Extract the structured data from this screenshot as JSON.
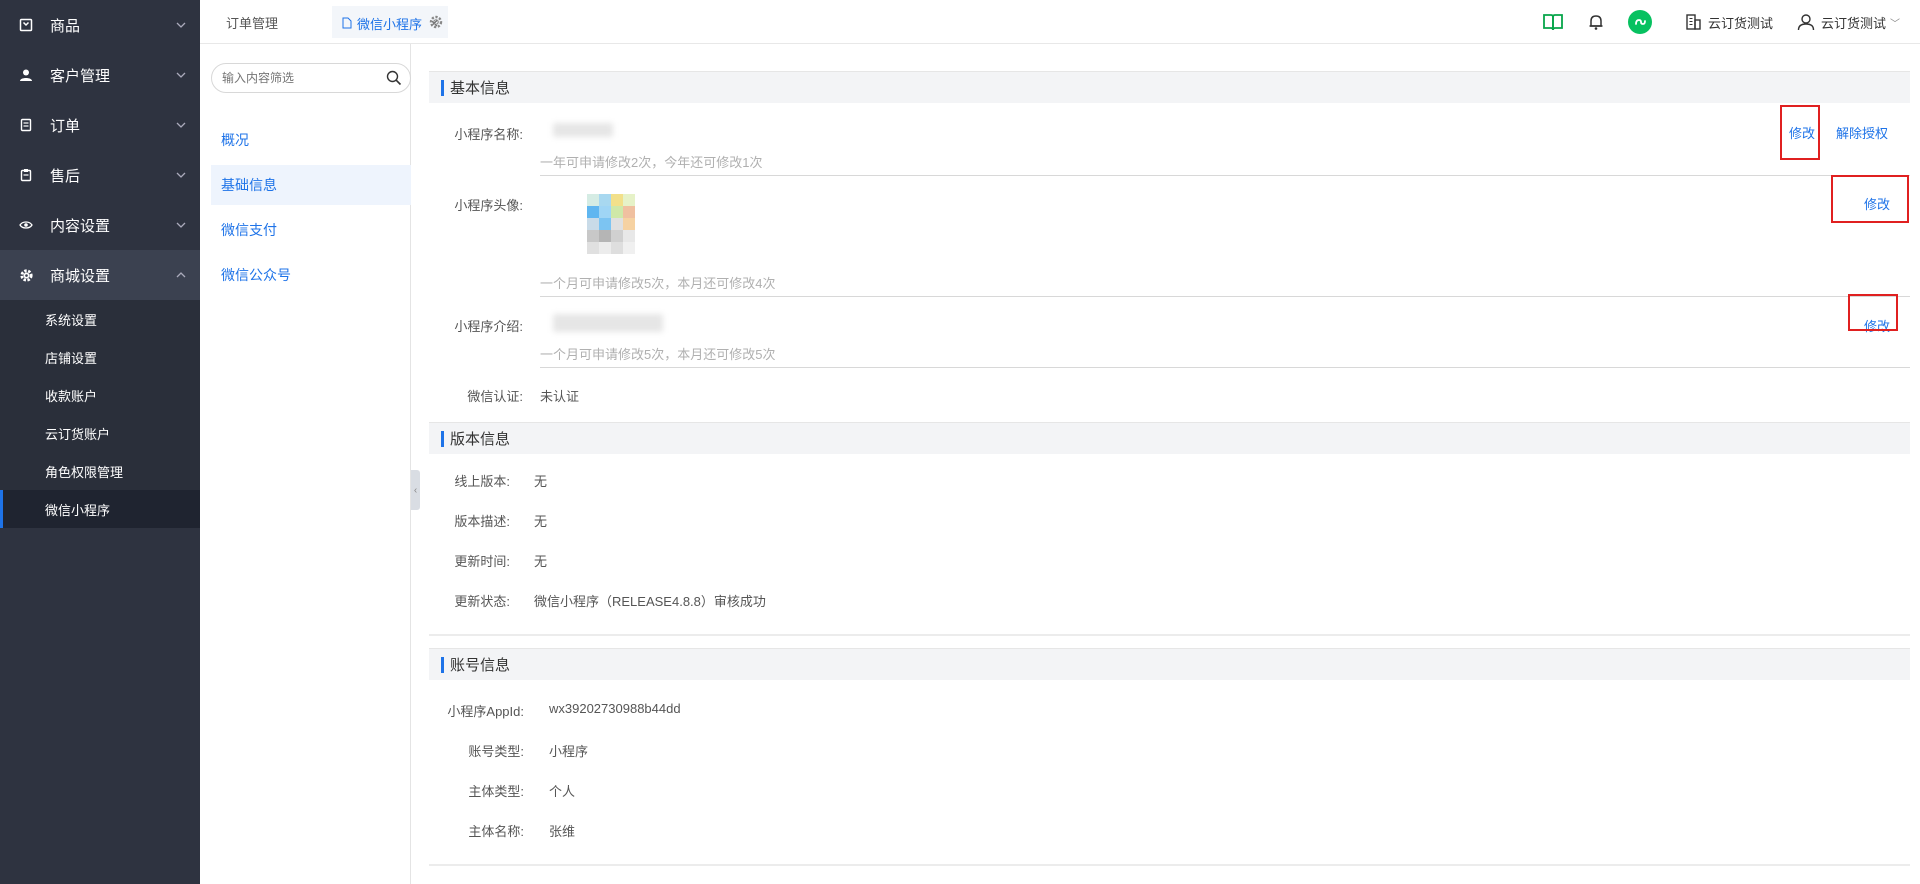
{
  "sidebar": {
    "groups": [
      {
        "label": "商品",
        "icon": "bag-icon"
      },
      {
        "label": "客户管理",
        "icon": "user-icon"
      },
      {
        "label": "订单",
        "icon": "document-icon"
      },
      {
        "label": "售后",
        "icon": "clipboard-icon"
      },
      {
        "label": "内容设置",
        "icon": "eye-icon"
      },
      {
        "label": "商城设置",
        "icon": "gear-icon"
      }
    ],
    "sub_items": [
      "系统设置",
      "店铺设置",
      "收款账户",
      "云订货账户",
      "角色权限管理",
      "微信小程序"
    ]
  },
  "tabs": {
    "tab1": "订单管理",
    "tab2": "微信小程序",
    "close": "×"
  },
  "topbar": {
    "org_name": "云订货测试",
    "user_name": "云订货测试",
    "caret": "﹀"
  },
  "subside": {
    "search_placeholder": "输入内容筛选",
    "items": [
      "概况",
      "基础信息",
      "微信支付",
      "微信公众号"
    ]
  },
  "basic": {
    "title": "基本信息",
    "name_label": "小程序名称:",
    "name_hint": "一年可申请修改2次，今年还可修改1次",
    "avatar_label": "小程序头像:",
    "avatar_hint": "一个月可申请修改5次，本月还可修改4次",
    "intro_label": "小程序介绍:",
    "intro_hint": "一个月可申请修改5次，本月还可修改5次",
    "cert_label": "微信认证:",
    "cert_value": "未认证",
    "edit": "修改",
    "unbind": "解除授权"
  },
  "version": {
    "title": "版本信息",
    "online_label": "线上版本:",
    "online_value": "无",
    "desc_label": "版本描述:",
    "desc_value": "无",
    "time_label": "更新时间:",
    "time_value": "无",
    "status_label": "更新状态:",
    "status_value": "微信小程序（RELEASE4.8.8）审核成功"
  },
  "account": {
    "title": "账号信息",
    "appid_label": "小程序AppId:",
    "appid_value": "wx39202730988b44dd",
    "type_label": "账号类型:",
    "type_value": "小程序",
    "subject_type_label": "主体类型:",
    "subject_type_value": "个人",
    "subject_name_label": "主体名称:",
    "subject_name_value": "张维"
  },
  "colors": {
    "sidebar_bg": "#2e3340",
    "accent": "#1e73e8",
    "highlight_box": "#e02020",
    "wechat_green": "#07c160"
  }
}
